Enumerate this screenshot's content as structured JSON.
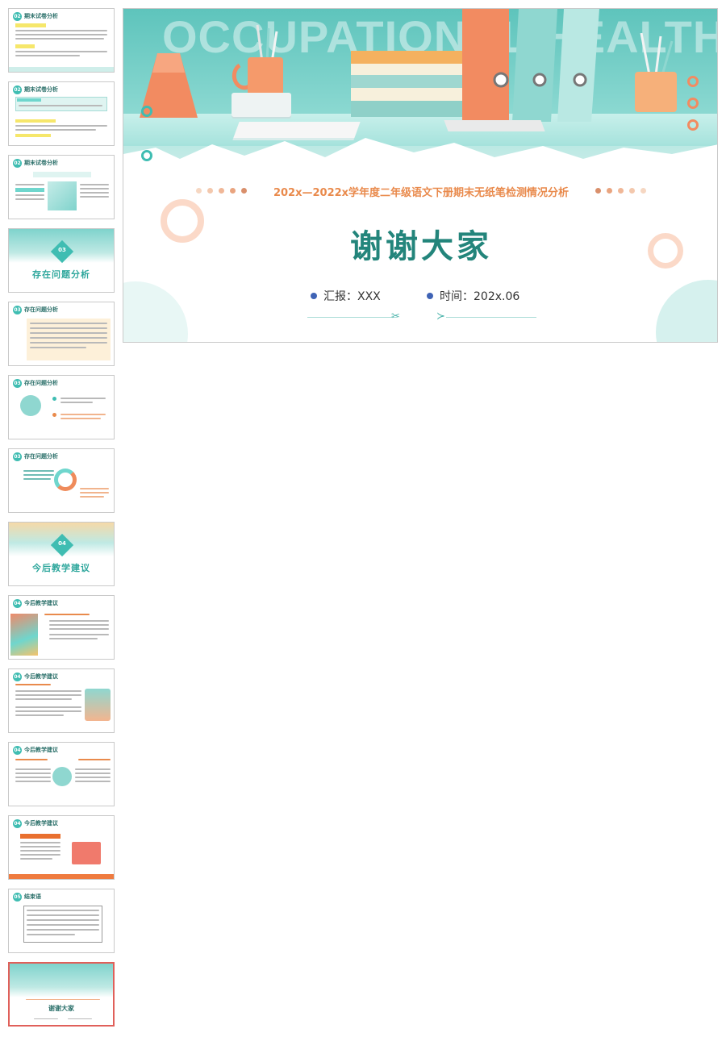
{
  "thumbnails": [
    {
      "badge": "02",
      "title": "期末试卷分析",
      "kind": "text"
    },
    {
      "badge": "02",
      "title": "期末试卷分析",
      "kind": "text"
    },
    {
      "badge": "02",
      "title": "期末试卷分析",
      "kind": "image-text"
    },
    {
      "badge": "03",
      "title": "存在问题分析",
      "kind": "section"
    },
    {
      "badge": "03",
      "title": "存在问题分析",
      "kind": "text"
    },
    {
      "badge": "03",
      "title": "存在问题分析",
      "kind": "circle"
    },
    {
      "badge": "03",
      "title": "存在问题分析",
      "kind": "ring"
    },
    {
      "badge": "04",
      "title": "今后教学建议",
      "kind": "section"
    },
    {
      "badge": "04",
      "title": "今后教学建议",
      "kind": "image-text"
    },
    {
      "badge": "04",
      "title": "今后教学建议",
      "kind": "text-image"
    },
    {
      "badge": "04",
      "title": "今后教学建议",
      "kind": "circle"
    },
    {
      "badge": "04",
      "title": "今后教学建议",
      "kind": "book"
    },
    {
      "badge": "05",
      "title": "结束语",
      "kind": "text"
    },
    {
      "badge": "",
      "title": "谢谢大家",
      "kind": "final"
    }
  ],
  "slide": {
    "watermark": "OCCUPATIONAL HEALTH",
    "subtitle": "202x—2022x学年度二年级语文下册期末无纸笔检测情况分析",
    "title": "谢谢大家",
    "reporter": "汇报：XXX",
    "time": "时间：202x.06"
  },
  "colors": {
    "accent_teal": "#23857b",
    "accent_orange": "#e98a4c",
    "bullet_blue": "#3f63b5",
    "selected_border": "#e0605a"
  }
}
